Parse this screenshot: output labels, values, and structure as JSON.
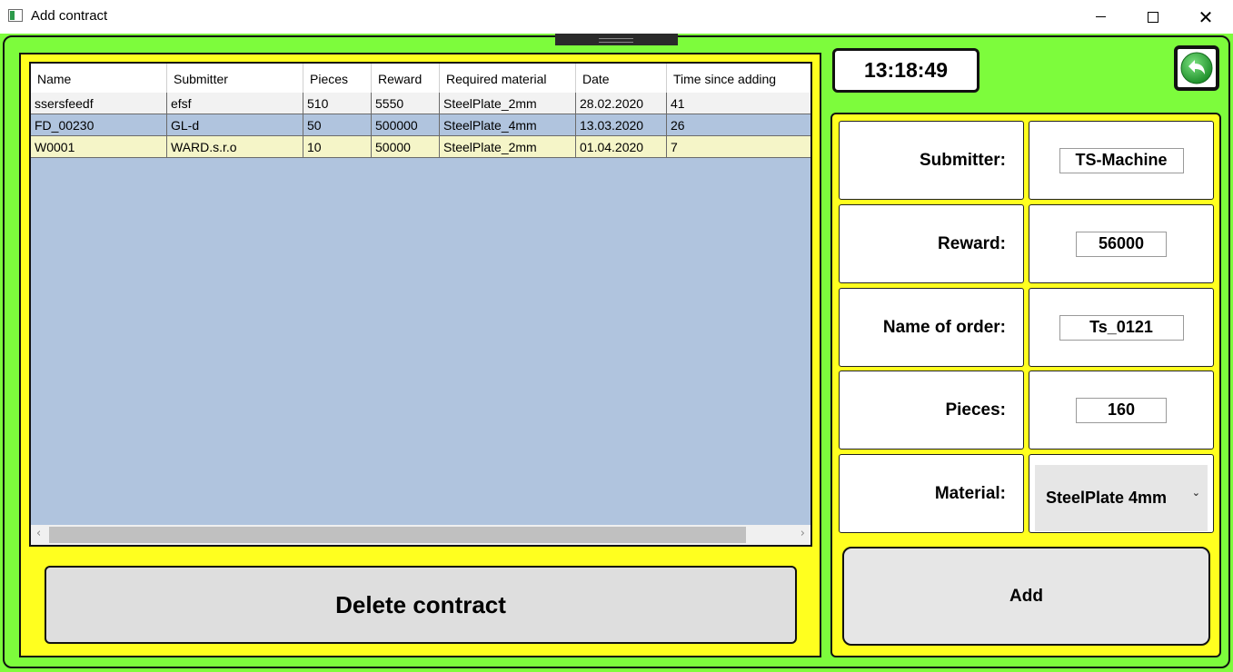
{
  "window": {
    "title": "Add contract"
  },
  "grid": {
    "columns": [
      "Name",
      "Submitter",
      "Pieces",
      "Reward",
      "Required material",
      "Date",
      "Time since adding"
    ],
    "rows": [
      {
        "cells": [
          "ssersfeedf",
          "efsf",
          "510",
          "5550",
          "SteelPlate_2mm",
          "28.02.2020",
          "41"
        ],
        "bg": "#f2f2f2"
      },
      {
        "cells": [
          "FD_00230",
          "GL-d",
          "50",
          "500000",
          "SteelPlate_4mm",
          "13.03.2020",
          "26"
        ],
        "bg": "#b0c4de"
      },
      {
        "cells": [
          "W0001",
          "WARD.s.r.o",
          "10",
          "50000",
          "SteelPlate_2mm",
          "01.04.2020",
          "7"
        ],
        "bg": "#f5f5c8"
      }
    ]
  },
  "actions": {
    "delete_label": "Delete contract",
    "add_label": "Add"
  },
  "clock": {
    "time": "13:18:49"
  },
  "form": {
    "submitter": {
      "label": "Submitter:",
      "value": "TS-Machine"
    },
    "reward": {
      "label": "Reward:",
      "value": "56000"
    },
    "name_of_order": {
      "label": "Name of order:",
      "value": "Ts_0121"
    },
    "pieces": {
      "label": "Pieces:",
      "value": "160"
    },
    "material": {
      "label": "Material:",
      "value": "SteelPlate 4mm"
    }
  },
  "icons": {
    "back": "back-arrow-icon",
    "dropdown": "chevron-down-icon"
  },
  "colors": {
    "background": "#7dfc3c",
    "panel": "#ffff1f",
    "grid_background": "#b0c4de",
    "back_icon": "#2fae3a"
  }
}
